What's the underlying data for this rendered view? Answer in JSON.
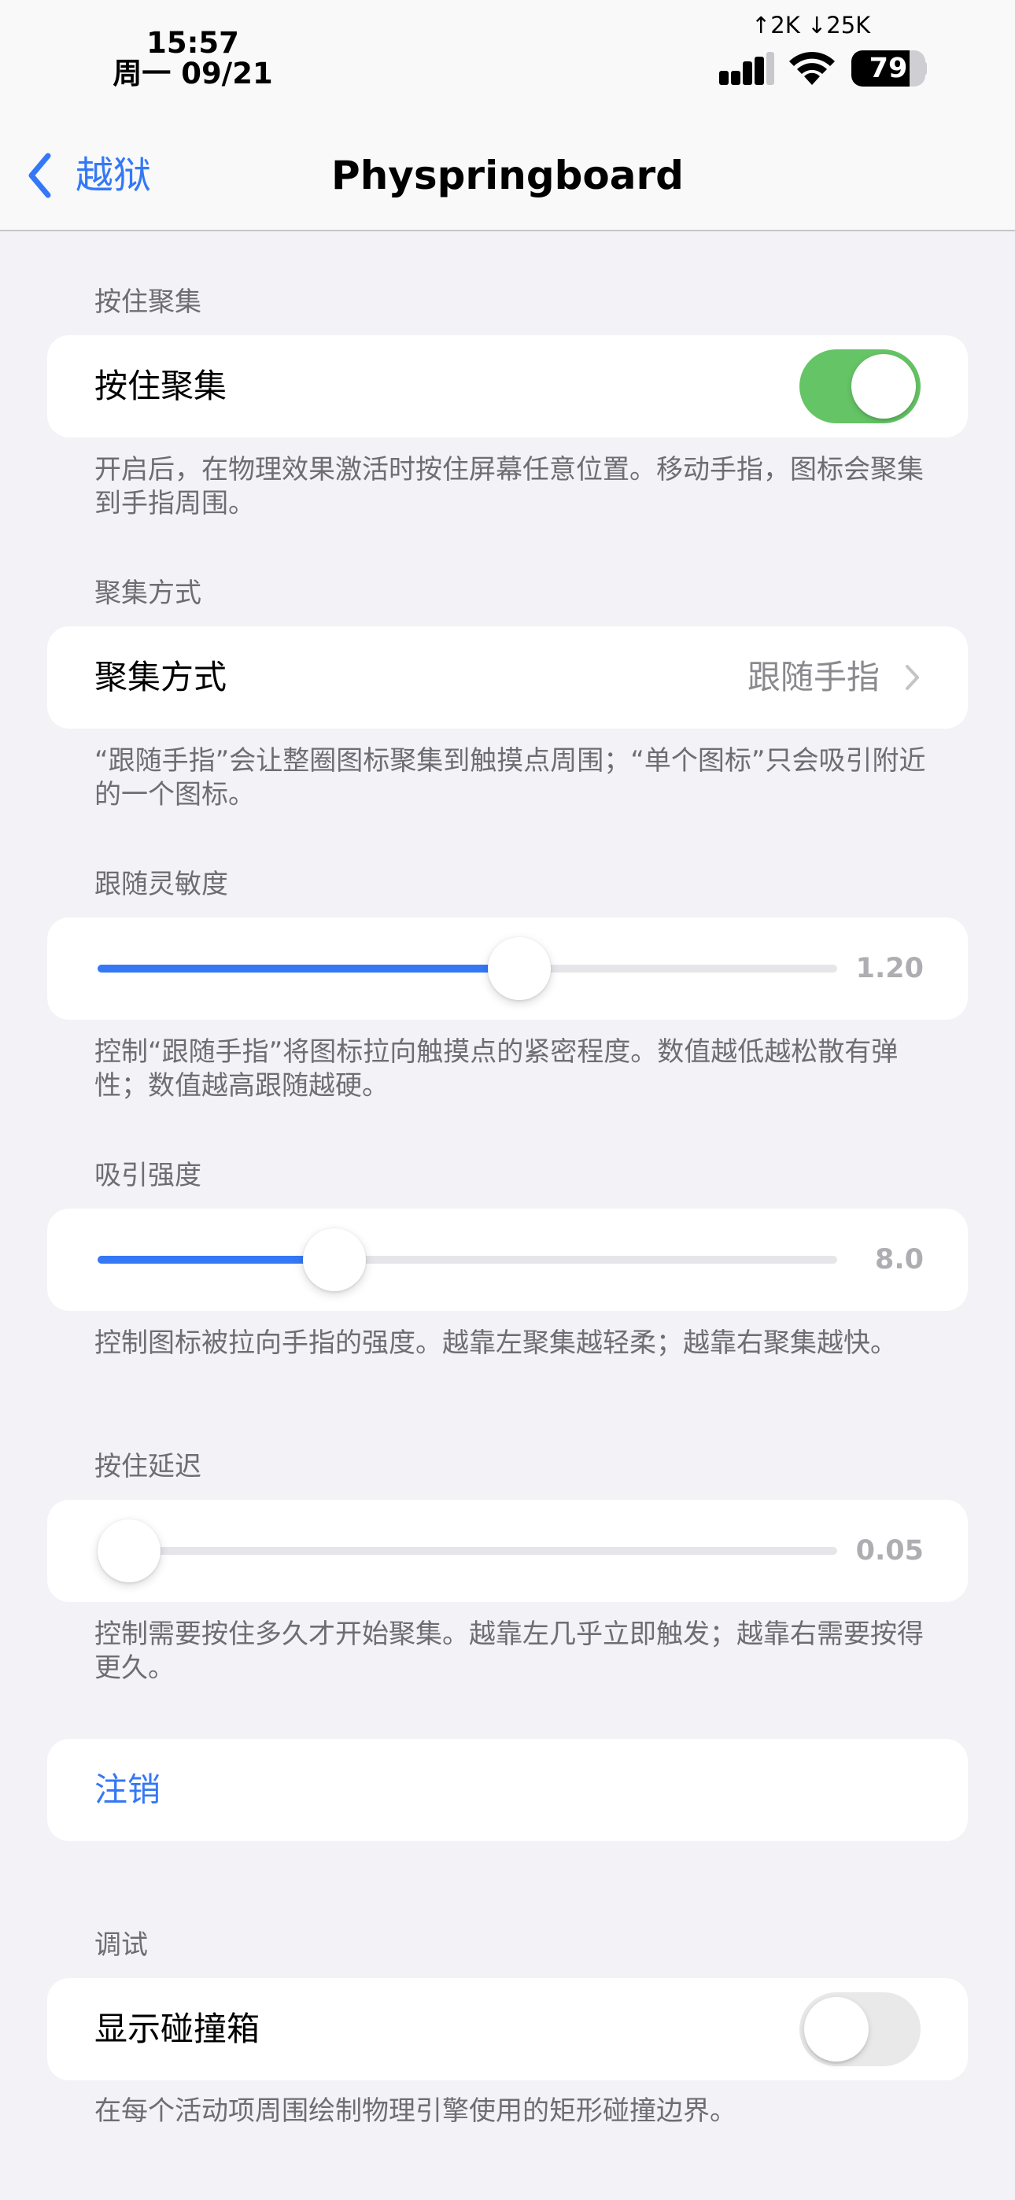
{
  "status_bar": {
    "time": "15:57",
    "date": "周一 09/21",
    "net_speed": "↑2K ↓25K",
    "battery": 79,
    "battery_label": "79",
    "icons": [
      "signal-icon",
      "wifi-icon",
      "battery-icon"
    ]
  },
  "nav": {
    "back_label": "越狱",
    "title": "Physpringboard",
    "accent": "#3478f6"
  },
  "sections": {
    "hold_gather": {
      "header": "按住聚集",
      "label": "按住聚集",
      "enabled": true,
      "footer": "开启后，在物理效果激活时按住屏幕任意位置。移动手指，图标会聚集到手指周围。"
    },
    "gather_mode": {
      "header": "聚集方式",
      "label": "聚集方式",
      "value": "跟随手指",
      "footer": "“跟随手指”会让整圈图标聚集到触摸点周围；“单个图标”只会吸引附近的一个图标。"
    },
    "follow_sensitivity": {
      "header": "跟随灵敏度",
      "value_label": "1.20",
      "fraction": 0.57,
      "footer": "控制“跟随手指”将图标拉向触摸点的紧密程度。数值越低越松散有弹性；数值越高跟随越硬。"
    },
    "attraction_strength": {
      "header": "吸引强度",
      "value_label": "8.0",
      "fraction": 0.32,
      "footer": "控制图标被拉向手指的强度。越靠左聚集越轻柔；越靠右聚集越快。"
    },
    "hold_delay": {
      "header": "按住延迟",
      "value_label": "0.05",
      "fraction": 0.04,
      "footer": "控制需要按住多久才开始聚集。越靠左几乎立即触发；越靠右需要按得更久。"
    },
    "logout": {
      "label": "注销"
    },
    "debug": {
      "header": "调试",
      "label": "显示碰撞箱",
      "enabled": false,
      "footer": "在每个活动项周围绘制物理引擎使用的矩形碰撞边界。"
    }
  },
  "colors": {
    "toggle_on": "#65c466",
    "toggle_off": "#e9e9ea",
    "slider_fill": "#3478f6",
    "background": "#f2f2f7"
  }
}
